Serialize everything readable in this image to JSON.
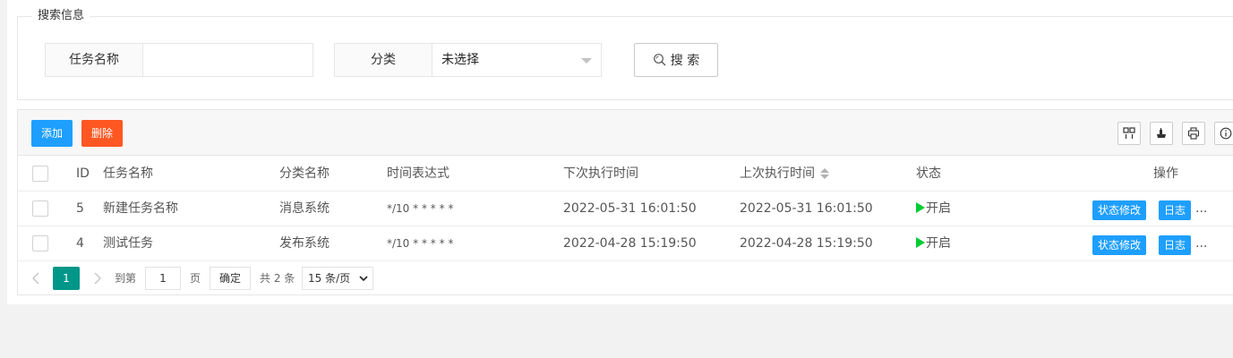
{
  "search": {
    "legend": "搜索信息",
    "task_name_label": "任务名称",
    "task_name_value": "",
    "category_label": "分类",
    "category_value": "未选择",
    "search_button": "搜 索"
  },
  "toolbar": {
    "add_label": "添加",
    "delete_label": "删除",
    "icons": [
      "columns-icon",
      "export-icon",
      "print-icon",
      "info-icon"
    ]
  },
  "table": {
    "headers": {
      "id": "ID",
      "task_name": "任务名称",
      "category": "分类名称",
      "cron": "时间表达式",
      "next_run": "下次执行时间",
      "last_run": "上次执行时间",
      "status": "状态",
      "actions": "操作"
    },
    "rows": [
      {
        "id": "5",
        "task_name": "新建任务名称",
        "category": "消息系统",
        "cron": "*/10 * * * * *",
        "next_run": "2022-05-31 16:01:50",
        "last_run": "2022-05-31 16:01:50",
        "status": "开启",
        "status_color": "#00CC33",
        "edit_status_label": "状态修改",
        "log_label": "日志",
        "more_label": "..."
      },
      {
        "id": "4",
        "task_name": "测试任务",
        "category": "发布系统",
        "cron": "*/10 * * * * *",
        "next_run": "2022-04-28 15:19:50",
        "last_run": "2022-04-28 15:19:50",
        "status": "开启",
        "status_color": "#00CC33",
        "edit_status_label": "状态修改",
        "log_label": "日志",
        "more_label": "..."
      }
    ]
  },
  "pager": {
    "current_page": "1",
    "goto_label": "到第",
    "goto_value": "1",
    "page_label": "页",
    "confirm_label": "确定",
    "total_label": "共 2 条",
    "page_size_label": "15 条/页"
  },
  "colors": {
    "primary": "#1E9FFF",
    "danger": "#FF5722",
    "pager_active": "#009688",
    "status_on": "#00CC33"
  }
}
